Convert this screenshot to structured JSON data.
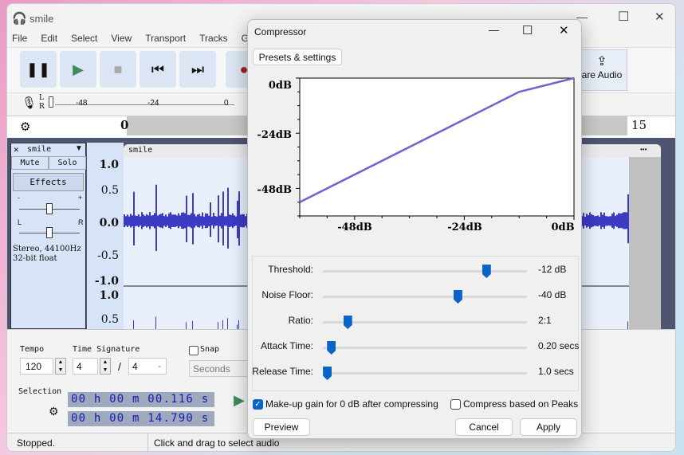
{
  "window": {
    "title": "smile",
    "minimize": "—",
    "maximize": "☐",
    "close": "✕"
  },
  "menu": [
    "File",
    "Edit",
    "Select",
    "View",
    "Transport",
    "Tracks",
    "Genera"
  ],
  "transport": {
    "pause": "pause-icon",
    "play": "play-icon",
    "stop": "stop-icon",
    "skip_start": "skip-start-icon",
    "skip_end": "skip-end-icon",
    "record": "record-icon"
  },
  "share_audio": "are Audio",
  "meter": {
    "l": "L",
    "r": "R",
    "ticks": [
      "-48",
      "-24",
      "0"
    ]
  },
  "timeline": {
    "start": "0",
    "end": "15"
  },
  "track": {
    "name": "smile",
    "mute": "Mute",
    "solo": "Solo",
    "effects": "Effects",
    "gain_minus": "-",
    "gain_plus": "+",
    "pan_l": "L",
    "pan_r": "R",
    "info1": "Stereo, 44100Hz",
    "info2": "32-bit float",
    "clip_name": "smile",
    "menu_dots": "•••",
    "scale_top": [
      "1.0",
      "0.5",
      "0.0",
      "-0.5",
      "-1.0"
    ],
    "scale_bottom": [
      "1.0",
      "0.5"
    ]
  },
  "bottom": {
    "tempo_label": "Tempo",
    "tempo": "120",
    "timesig_label": "Time Signature",
    "timesig_num": "4",
    "timesig_sep": "/",
    "timesig_den": "4",
    "snap": "Snap",
    "snap_unit": "Seconds",
    "selection_label": "Selection",
    "sel_start": "00 h 00 m 00.116 s",
    "sel_end": "00 h 00 m 14.790 s"
  },
  "status": {
    "left": "Stopped.",
    "right": "Click and drag to select audio"
  },
  "dialog": {
    "title": "Compressor",
    "presets": "Presets & settings",
    "sliders": [
      {
        "label": "Threshold:",
        "value": "-12 dB",
        "fraction": 0.8
      },
      {
        "label": "Noise Floor:",
        "value": "-40 dB",
        "fraction": 0.66
      },
      {
        "label": "Ratio:",
        "value": "2:1",
        "fraction": 0.12
      },
      {
        "label": "Attack Time:",
        "value": "0.20 secs",
        "fraction": 0.04
      },
      {
        "label": "Release Time:",
        "value": "1.0 secs",
        "fraction": 0.02
      }
    ],
    "makeup": "Make-up gain for 0 dB after compressing",
    "makeup_checked": true,
    "peaks": "Compress based on Peaks",
    "peaks_checked": false,
    "preview": "Preview",
    "cancel": "Cancel",
    "apply": "Apply"
  },
  "chart_data": {
    "type": "line",
    "xlim": [
      -60,
      0
    ],
    "ylim": [
      -60,
      0
    ],
    "x_ticks": [
      "-48dB",
      "-24dB",
      "0dB"
    ],
    "y_ticks": [
      "0dB",
      "-24dB",
      "-48dB"
    ],
    "series": [
      {
        "x": [
          -60,
          -12,
          0
        ],
        "y": [
          -54,
          -6,
          0
        ],
        "color": "#6a67d0"
      }
    ]
  }
}
